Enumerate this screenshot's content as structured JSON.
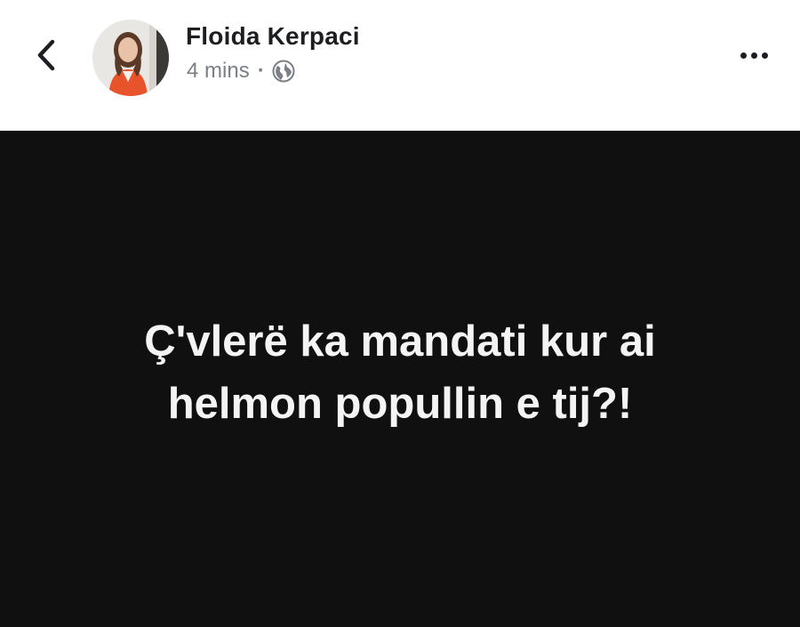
{
  "header": {
    "back_icon": "chevron-left-icon",
    "author_name": "Floida Kerpaci",
    "timestamp": "4 mins",
    "separator": "·",
    "privacy_icon": "globe-icon",
    "more_icon": "more-horizontal-icon"
  },
  "post": {
    "background_color": "#101010",
    "text_color": "#f4f4f4",
    "lines": [
      "Ç'vlerë ka mandati kur ai",
      "helmon popullin e tij?!"
    ]
  }
}
